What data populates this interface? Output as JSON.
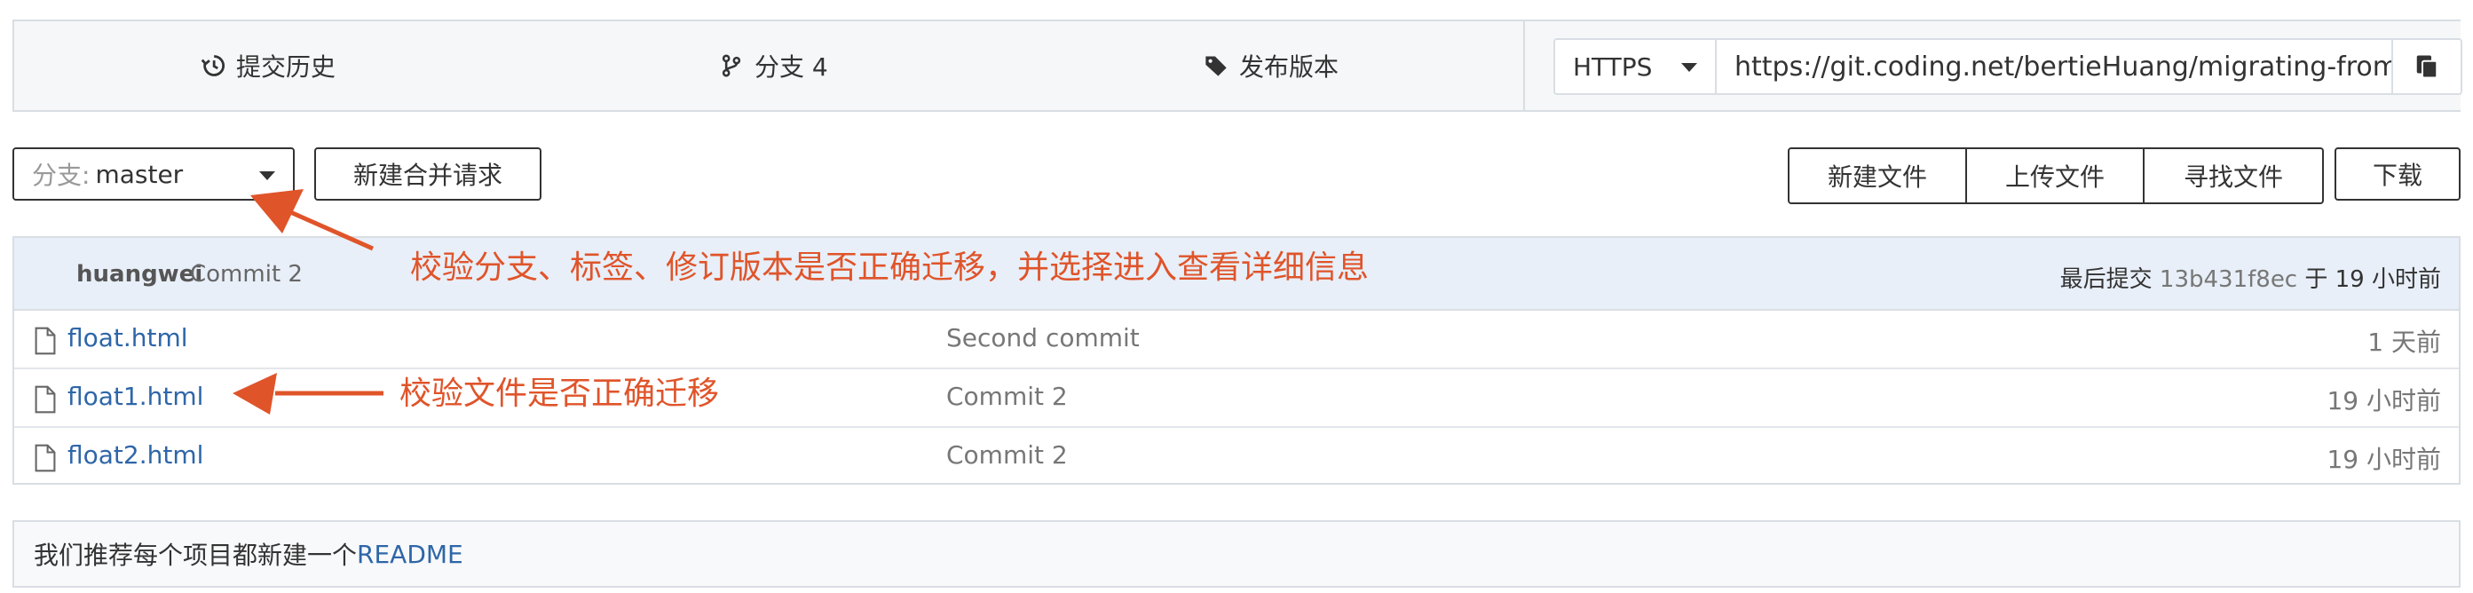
{
  "nav": {
    "history_label": "提交历史",
    "branch_label": "分支 4",
    "release_label": "发布版本"
  },
  "clone": {
    "protocol": "HTTPS",
    "url": "https://git.coding.net/bertieHuang/migrating-from"
  },
  "toolbar": {
    "branch_prefix": "分支:",
    "branch_value": "master",
    "new_merge_request": "新建合并请求",
    "new_file": "新建文件",
    "upload_file": "上传文件",
    "find_file": "寻找文件",
    "download": "下载"
  },
  "commit": {
    "author": "huangwei",
    "message": "Commit 2",
    "last_label": "最后提交",
    "sha": "13b431f8ec",
    "time": "于 19 小时前"
  },
  "files": [
    {
      "name": "float.html",
      "message": "Second commit",
      "time": "1 天前"
    },
    {
      "name": "float1.html",
      "message": "Commit 2",
      "time": "19 小时前"
    },
    {
      "name": "float2.html",
      "message": "Commit 2",
      "time": "19 小时前"
    }
  ],
  "readme": {
    "text": "我们推荐每个项目都新建一个",
    "link": "README"
  },
  "annotations": {
    "branch_note": "校验分支、标签、修订版本是否正确迁移，并选择进入查看详细信息",
    "file_note": "校验文件是否正确迁移"
  },
  "colors": {
    "annotation": "#e0542a",
    "link": "#2e66a8",
    "header_bg": "#e8eff8"
  }
}
